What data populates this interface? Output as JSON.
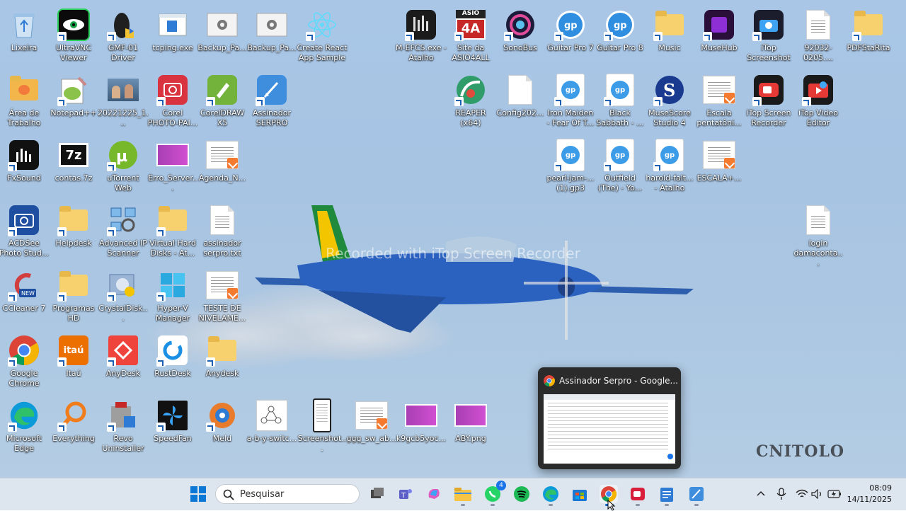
{
  "desktop": {
    "watermark": "Recorded with iTop Screen Recorder",
    "brand": "CNITOLO",
    "icons": [
      {
        "label": "Lixeira",
        "icon": "recycle-bin-icon"
      },
      {
        "label": "UltraVNC Viewer",
        "icon": "ultravnc-icon"
      },
      {
        "label": "GMF-01 Driver",
        "icon": "mouse-driver-icon"
      },
      {
        "label": "tcping.exe",
        "icon": "exe-window-icon"
      },
      {
        "label": "Backup_Pa...",
        "icon": "settings-file-icon"
      },
      {
        "label": "Backup_Pa...",
        "icon": "settings-file-icon"
      },
      {
        "label": "Create React App Sample",
        "icon": "react-icon"
      },
      {
        "label": "M-EFCS.exe - Atalho",
        "icon": "mefcs-icon"
      },
      {
        "label": "Site da ASIO4ALL",
        "icon": "asio4all-icon"
      },
      {
        "label": "SonoBus",
        "icon": "sonobus-icon"
      },
      {
        "label": "Guitar Pro 7",
        "icon": "guitar-pro-icon"
      },
      {
        "label": "Guitar Pro 8",
        "icon": "guitar-pro-icon"
      },
      {
        "label": "Music",
        "icon": "folder-icon"
      },
      {
        "label": "MuseHub",
        "icon": "musehub-icon"
      },
      {
        "label": "iTop Screenshot",
        "icon": "itop-screenshot-icon"
      },
      {
        "label": "92032-0205....",
        "icon": "text-file-icon"
      },
      {
        "label": "PDFStaRita",
        "icon": "folder-icon"
      },
      {
        "label": "Área de Trabalho",
        "icon": "desktop-folder-icon"
      },
      {
        "label": "Notepad++",
        "icon": "notepadpp-icon"
      },
      {
        "label": "20221225_1...",
        "icon": "photo-icon"
      },
      {
        "label": "Corel PHOTO-PAI...",
        "icon": "corel-photopaint-icon"
      },
      {
        "label": "CorelDRAW X5",
        "icon": "coreldraw-icon"
      },
      {
        "label": "Assinador SERPRO",
        "icon": "assinador-icon"
      },
      {
        "label": "REAPER (x64)",
        "icon": "reaper-icon"
      },
      {
        "label": "Config202...",
        "icon": "blank-file-icon"
      },
      {
        "label": "Iron Maiden - Fear Of T...",
        "icon": "gp-file-icon"
      },
      {
        "label": "Black Sabbath - ...",
        "icon": "gp-file-icon"
      },
      {
        "label": "MuseScore Studio 4",
        "icon": "musescore-icon"
      },
      {
        "label": "Escala pentatôni...",
        "icon": "pdf-doc-icon"
      },
      {
        "label": "iTop Screen Recorder",
        "icon": "itop-recorder-icon"
      },
      {
        "label": "iTop Video Editor",
        "icon": "itop-video-editor-icon"
      },
      {
        "label": "FxSound",
        "icon": "fxsound-icon"
      },
      {
        "label": "contas.7z",
        "icon": "7z-icon"
      },
      {
        "label": "uTorrent Web",
        "icon": "utorrent-icon"
      },
      {
        "label": "Erro_Server...",
        "icon": "image-file-icon"
      },
      {
        "label": "Agenda_N...",
        "icon": "pdf-doc-icon"
      },
      {
        "label": "pearl-jam-... (1).gp3",
        "icon": "gp-file-icon"
      },
      {
        "label": "Outfield (The) - Yo...",
        "icon": "gp-file-icon"
      },
      {
        "label": "harold-falt... - Atalho",
        "icon": "gp-file-icon"
      },
      {
        "label": "ESCALA+...",
        "icon": "pdf-doc-icon"
      },
      {
        "label": "ACDSee Photo Stud...",
        "icon": "acdsee-icon"
      },
      {
        "label": "Helpdesk",
        "icon": "folder-icon"
      },
      {
        "label": "Advanced IP Scanner",
        "icon": "ip-scanner-icon"
      },
      {
        "label": "Virtual Hard Disks - At...",
        "icon": "folder-icon"
      },
      {
        "label": "assinador serpro.txt",
        "icon": "text-file-icon"
      },
      {
        "label": "login damaconta...",
        "icon": "text-file-icon"
      },
      {
        "label": "CCleaner 7",
        "icon": "ccleaner-icon"
      },
      {
        "label": "Programas HD",
        "icon": "folder-icon"
      },
      {
        "label": "CrystalDisk...",
        "icon": "crystaldisk-icon"
      },
      {
        "label": "Hyper-V Manager",
        "icon": "hyperv-icon"
      },
      {
        "label": "TESTE DE NIVELAME...",
        "icon": "pdf-doc-icon"
      },
      {
        "label": "Google Chrome",
        "icon": "chrome-icon"
      },
      {
        "label": "Itaú",
        "icon": "itau-icon"
      },
      {
        "label": "AnyDesk",
        "icon": "anydesk-icon"
      },
      {
        "label": "RustDesk",
        "icon": "rustdesk-icon"
      },
      {
        "label": "Anydesk",
        "icon": "folder-icon"
      },
      {
        "label": "Microsoft Edge",
        "icon": "edge-icon"
      },
      {
        "label": "Everything",
        "icon": "everything-icon"
      },
      {
        "label": "Revo Uninstaller",
        "icon": "revo-icon"
      },
      {
        "label": "SpeedFan",
        "icon": "speedfan-icon"
      },
      {
        "label": "Meld",
        "icon": "meld-icon"
      },
      {
        "label": "a-b-y-switc...",
        "icon": "diagram-image-icon"
      },
      {
        "label": "Screenshot...",
        "icon": "phone-screenshot-icon"
      },
      {
        "label": "ggg_sw_ab...",
        "icon": "pdf-doc-icon"
      },
      {
        "label": "k9gcb5yoc...",
        "icon": "image-file-icon"
      },
      {
        "label": "ABY.png",
        "icon": "image-file-icon"
      }
    ]
  },
  "preview": {
    "title": "Assinador Serpro - Google..."
  },
  "taskbar": {
    "search_placeholder": "Pesquisar",
    "whatsapp_badge": "4",
    "time": "08:09",
    "date": "14/11/2025"
  }
}
